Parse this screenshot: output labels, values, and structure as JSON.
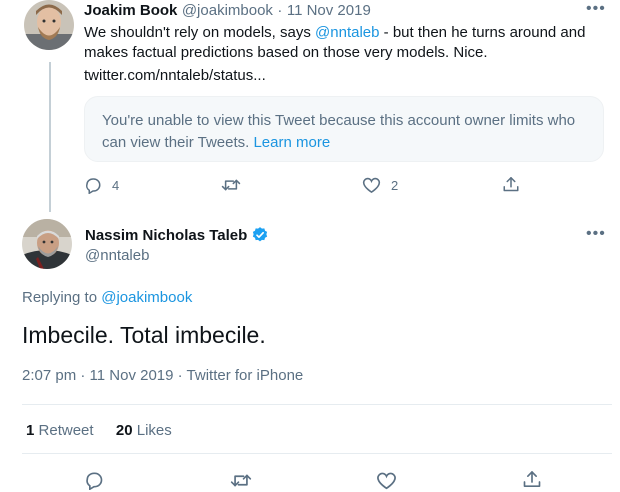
{
  "reply_tweet": {
    "author_name": "Joakim Book",
    "author_handle": "@joakimbook",
    "separator": "·",
    "date": "11 Nov 2019",
    "text_before_mention": "We shouldn't rely on models, says ",
    "mention": "@nntaleb",
    "text_after_mention": " - but then he turns around and makes factual predictions based on those very models. Nice.",
    "link": "twitter.com/nntaleb/status...",
    "quoted_notice": "You're unable to view this Tweet because this account owner limits who can view their Tweets.",
    "quoted_learn_more": "Learn more",
    "reply_count": "4",
    "like_count": "2"
  },
  "main_tweet": {
    "author_name": "Nassim Nicholas Taleb",
    "author_handle": "@nntaleb",
    "replying_prefix": "Replying to ",
    "replying_to": "@joakimbook",
    "text": "Imbecile. Total imbecile.",
    "timestamp": "2:07 pm · 11 Nov 2019 · Twitter for iPhone",
    "retweet_count": "1",
    "retweet_label": "Retweet",
    "like_count": "20",
    "like_label": "Likes"
  },
  "icons": [
    "reply-icon",
    "retweet-icon",
    "like-icon",
    "share-icon",
    "more-icon",
    "verified-badge-icon"
  ],
  "colors": {
    "accent": "#1b95e0",
    "muted": "#5b7083",
    "text": "#0f1419",
    "card_bg": "#f5f8fa"
  }
}
